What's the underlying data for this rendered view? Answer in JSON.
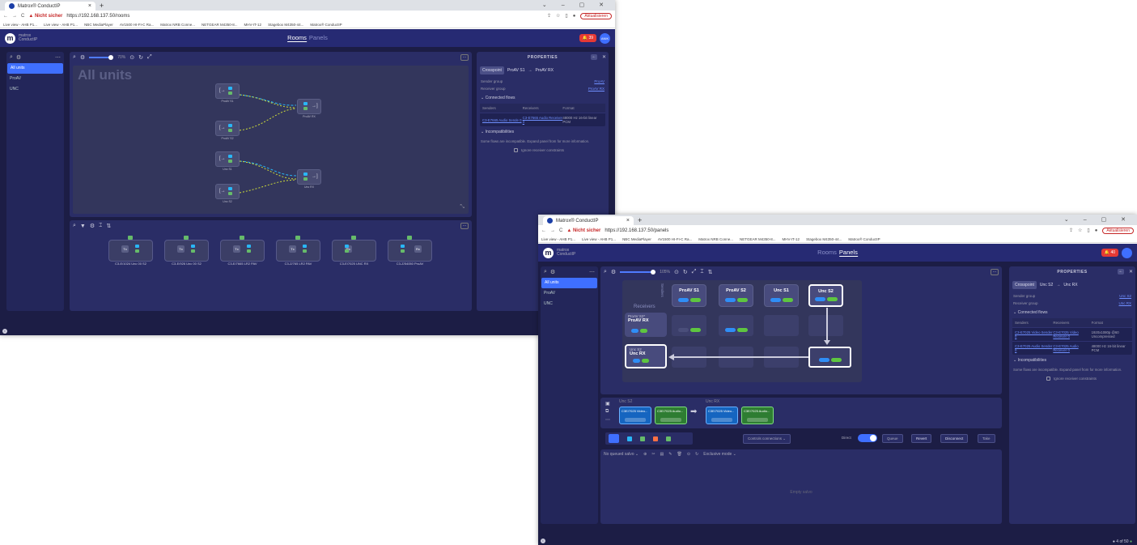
{
  "w1": {
    "tab_title": "Matrox® ConductIP",
    "url": "https://192.168.137.50/rooms",
    "warn": "Nicht sicher",
    "update": "Aktualisieren",
    "bookmarks": [
      "Live view - AHB P1...",
      "Live view - AHB P1...",
      "NBC MediaPlayer",
      "AV1500 HI-FI-C Ra...",
      "Matrox NRB Conne...",
      "NETGEAR M4350-8...",
      "MHV-IT-12",
      "Stagebox M4350-44...",
      "Matrox® ConductIP"
    ],
    "brand_line1": "matrox",
    "brand_line2": "ConductIP",
    "nav": [
      "Rooms",
      "Panels"
    ],
    "notif": "39",
    "avatar": "ANIK",
    "sidebar": [
      "All units",
      "ProAV",
      "UNC"
    ],
    "zoom": "70%",
    "canvas_title": "All units",
    "nodes": [
      "ProAV S1",
      "ProAV RX",
      "ProAV S2",
      "Unc S1",
      "Unc RX",
      "Unc S2"
    ],
    "units": [
      "C3-E/1024 Unc 00 S2",
      "C3-E/926 Unc 00 S2",
      "C3-E/7665 LR2 PAV",
      "C3-Z/765 LR2 PAV",
      "C3-E/7025 UNC RX",
      "C3-Z/54050 ProAV"
    ],
    "properties": {
      "title": "PROPERTIES",
      "crosspoint": "Crosspoint",
      "from": "ProAV S1",
      "to": "ProAV RX",
      "sender_group_label": "Sender group",
      "sender_group": "ProAV",
      "receiver_group_label": "Receiver group",
      "receiver_group": "ProAV RX",
      "connected_flows": "Connected flows",
      "headers": [
        "Senders",
        "Receivers",
        "Format"
      ],
      "row": [
        "C3-E7665 Audio Sende 0",
        "C3-E7665 Audio Receiver 3",
        "48000 Hz 16-bit linear PCM"
      ],
      "incompat": "Incompatibilities",
      "note": "Some flows are incompatible. Expand panel from for more information.",
      "ignore": "Ignore receiver constraints"
    }
  },
  "w2": {
    "tab_title": "Matrox® ConductIP",
    "url": "https://192.168.137.50/panels",
    "warn": "Nicht sicher",
    "update": "Aktualisieren",
    "bookmarks": [
      "Live view - AHB P1...",
      "Live view - AHB P1...",
      "NBC MediaPlayer",
      "AV1500 HI-FI-C Ra...",
      "Matrox NRB Conne...",
      "NETGEAR M4350-8...",
      "MHV-IT-12",
      "Stagebox M4350-44...",
      "Matrox® ConductIP"
    ],
    "brand_line1": "matrox",
    "brand_line2": "ConductIP",
    "nav": [
      "Rooms",
      "Panels"
    ],
    "notif": "40",
    "sidebar": [
      "All units",
      "ProAV",
      "UNC"
    ],
    "zoom": "105%",
    "receivers_label": "Receivers",
    "senders_label": "Senders",
    "cols": [
      "ProAV S1",
      "ProAV S2",
      "Unc S1",
      "Unc S2"
    ],
    "row1": {
      "sub": "ProAV S2*",
      "name": "ProAV RX"
    },
    "row2": {
      "sub": "Unc S2",
      "name": "Unc RX"
    },
    "flow_left_title": "Unc S2",
    "flow_right_title": "Unc RX",
    "flows_left": [
      "C3E/7025 Video...",
      "C3E/7025 Audio..."
    ],
    "flows_right": [
      "C3E/7025 Video...",
      "C3E/7025 Audio..."
    ],
    "connect_dropdown": "Controls connections",
    "direct": "Direct",
    "buttons": [
      "Queue",
      "Revert",
      "Disconnect",
      "Take"
    ],
    "salvo": "No queued salvo",
    "exclusive": "Exclusive mode",
    "empty": "Empty salvo",
    "properties": {
      "title": "PROPERTIES",
      "crosspoint": "Crosspoint",
      "from": "Unc S2",
      "to": "Unc RX",
      "sender_group_label": "Sender group",
      "sender_group": "Unc S2",
      "receiver_group_label": "Receiver group",
      "receiver_group": "Unc RX",
      "connected_flows": "Connected flows",
      "headers": [
        "Senders",
        "Receivers",
        "Format"
      ],
      "row1": [
        "C3-E7025 Video Sender 0",
        "C3-E7025 Video Receiver 0",
        "1920x1080p @60 Uncompressed"
      ],
      "row2": [
        "C3-E7025 Audio Sender 0",
        "C3-E7025 Audio Receiver 0",
        "48000 Hz 16-bit linear PCM"
      ],
      "incompat": "Incompatibilities",
      "note": "Some flows are incompatible. Expand panel from for more information.",
      "ignore": "Ignore receiver constraints"
    },
    "status": "4 of 50"
  }
}
